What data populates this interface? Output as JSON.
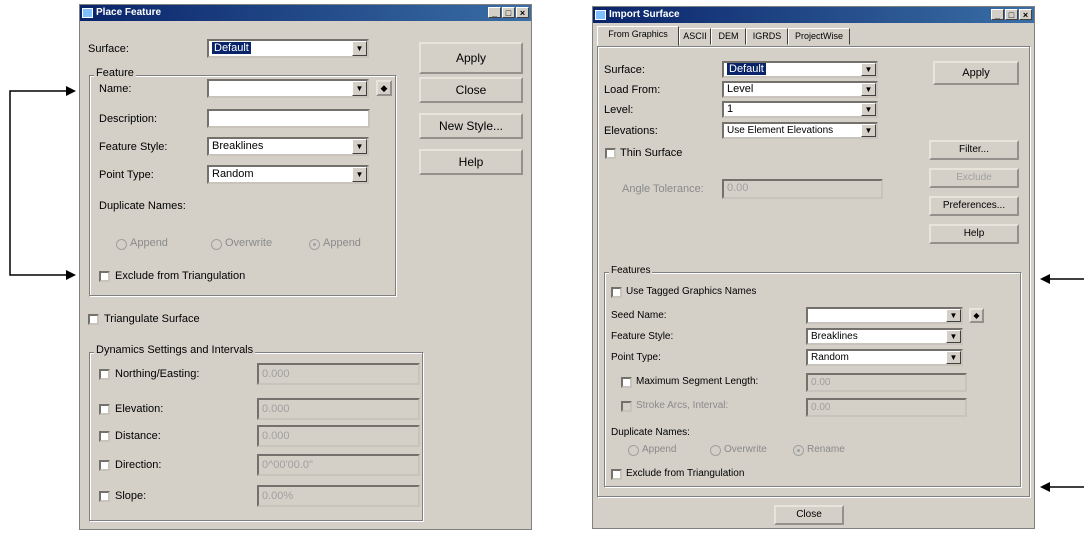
{
  "left_dialog": {
    "title": "Place Feature",
    "surface_label": "Surface:",
    "surface_value": "Default",
    "feature_group": "Feature",
    "name_label": "Name:",
    "name_value": "",
    "description_label": "Description:",
    "description_value": "",
    "feature_style_label": "Feature Style:",
    "feature_style_value": "Breaklines",
    "point_type_label": "Point Type:",
    "point_type_value": "Random",
    "duplicate_names_label": "Duplicate Names:",
    "dup_options": [
      "Append",
      "Overwrite",
      "Append"
    ],
    "exclude_label": "Exclude from Triangulation",
    "triangulate_label": "Triangulate Surface",
    "dynamics_group": "Dynamics Settings and Intervals",
    "dynamics": [
      {
        "label": "Northing/Easting:",
        "value": "0.000"
      },
      {
        "label": "Elevation:",
        "value": "0.000"
      },
      {
        "label": "Distance:",
        "value": "0.000"
      },
      {
        "label": "Direction:",
        "value": "0^00'00.0\""
      },
      {
        "label": "Slope:",
        "value": "0.00%"
      }
    ],
    "buttons": {
      "apply": "Apply",
      "close": "Close",
      "new_style": "New Style...",
      "help": "Help"
    }
  },
  "right_dialog": {
    "title": "Import Surface",
    "tabs": [
      "From Graphics",
      "ASCII",
      "DEM",
      "IGRDS",
      "ProjectWise"
    ],
    "surface_label": "Surface:",
    "surface_value": "Default",
    "load_from_label": "Load From:",
    "load_from_value": "Level",
    "level_label": "Level:",
    "level_value": "1",
    "elevations_label": "Elevations:",
    "elevations_value": "Use Element Elevations",
    "thin_surface_label": "Thin Surface",
    "angle_tolerance_label": "Angle Tolerance:",
    "angle_tolerance_value": "0.00",
    "buttons": {
      "apply": "Apply",
      "filter": "Filter...",
      "exclude": "Exclude",
      "preferences": "Preferences...",
      "help": "Help",
      "close": "Close"
    },
    "feature_group": "Features",
    "use_tagged_label": "Use Tagged Graphics Names",
    "seed_name_label": "Seed Name:",
    "seed_name_value": "",
    "feature_style_label": "Feature Style:",
    "feature_style_value": "Breaklines",
    "point_type_label": "Point Type:",
    "point_type_value": "Random",
    "max_segment_label": "Maximum Segment Length:",
    "max_segment_value": "0.00",
    "stroke_label": "Stroke Arcs, Interval:",
    "stroke_value": "0.00",
    "duplicate_names_label": "Duplicate Names:",
    "dup_options": [
      "Append",
      "Overwrite",
      "Rename"
    ],
    "exclude_label": "Exclude from Triangulation"
  }
}
